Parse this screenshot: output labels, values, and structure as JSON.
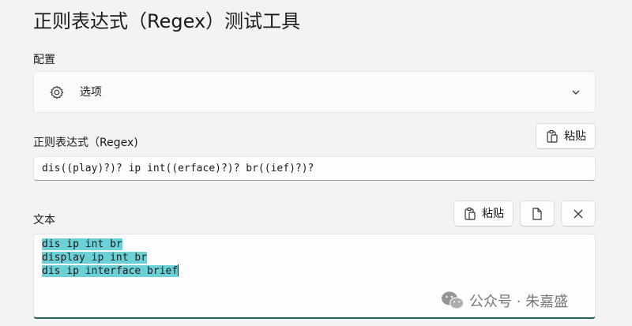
{
  "page_title": "正则表达式（Regex）测试工具",
  "config": {
    "section_label": "配置",
    "options": {
      "label": "选项",
      "icon": "gear-icon",
      "expand_icon": "chevron-down-icon"
    }
  },
  "regex": {
    "section_label": "正则表达式（Regex)",
    "paste_label": "粘贴",
    "paste_icon": "clipboard-paste-icon",
    "value": "dis((play)?)? ip int((erface)?)? br((ief)?)?"
  },
  "text": {
    "section_label": "文本",
    "paste_label": "粘贴",
    "paste_icon": "clipboard-paste-icon",
    "open_icon": "document-icon",
    "clear_icon": "close-icon",
    "lines": [
      "dis ip int br",
      "display ip int br",
      "dis ip interface brief"
    ],
    "highlight_color": "#6bd1d6"
  },
  "watermark": {
    "text": "公众号 · 朱嘉盛"
  },
  "colors": {
    "background": "#f3f3f3",
    "accent": "#1e5f57"
  }
}
